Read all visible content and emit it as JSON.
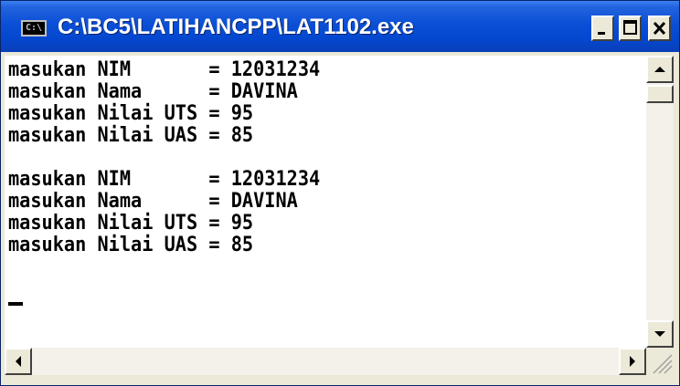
{
  "window": {
    "title": "C:\\BC5\\LATIHANCPP\\LAT1102.exe",
    "icon_label": "C:\\",
    "buttons": {
      "minimize": "minimize-icon",
      "maximize": "maximize-icon",
      "close": "close-icon"
    }
  },
  "console": {
    "lines": [
      "masukan NIM       = 12031234",
      "masukan Nama      = DAVINA",
      "masukan Nilai UTS = 95",
      "masukan Nilai UAS = 85",
      "",
      "masukan NIM       = 12031234",
      "masukan Nama      = DAVINA",
      "masukan Nilai UTS = 95",
      "masukan Nilai UAS = 85"
    ]
  },
  "colors": {
    "titlebar": "#0a4fd6",
    "console_bg": "#ffffff",
    "console_text": "#000000"
  }
}
